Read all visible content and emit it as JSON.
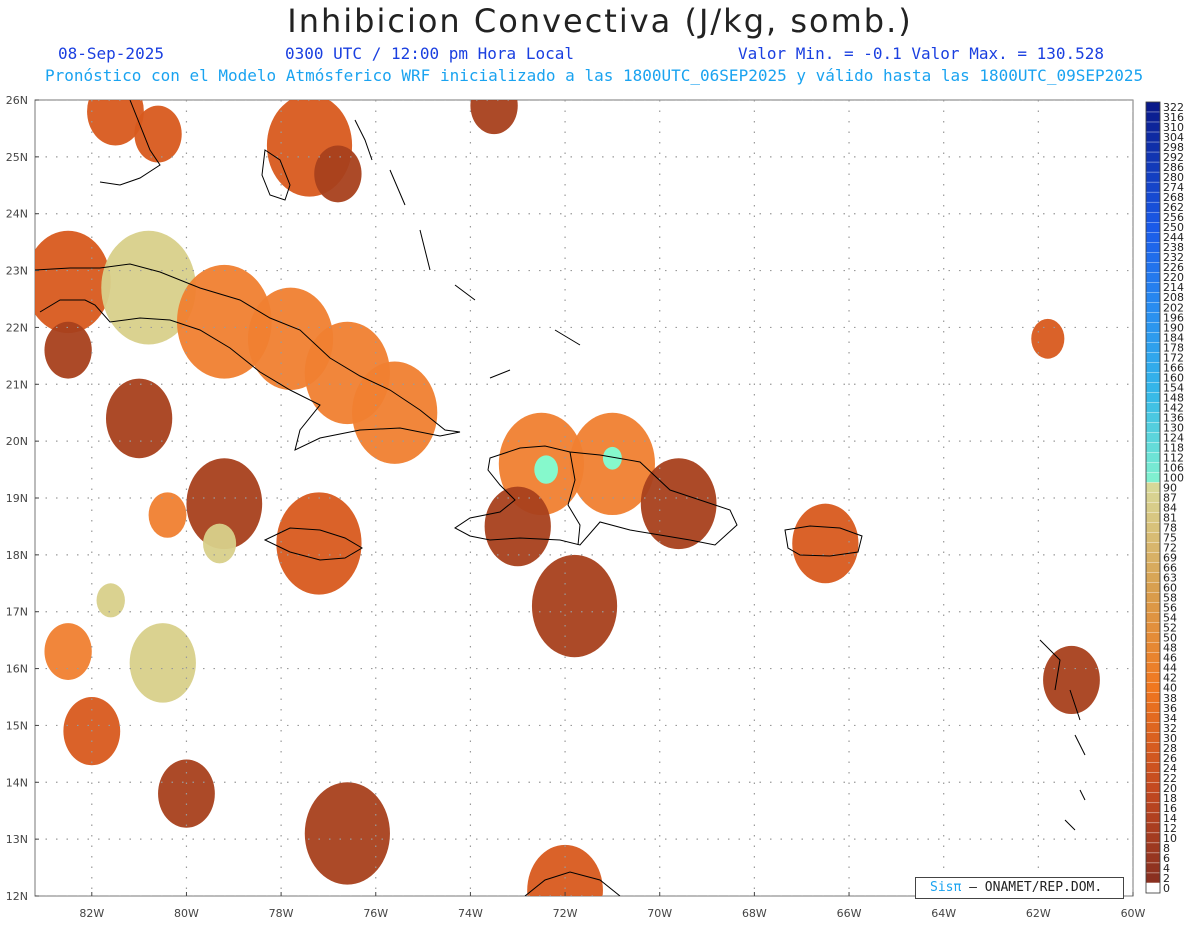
{
  "header": {
    "title": "Inhibicion Convectiva (J/kg, somb.)",
    "date": "08-Sep-2025",
    "time": "0300 UTC / 12:00 pm Hora Local",
    "min_max": "Valor Min. = -0.1  Valor Max. = 130.528",
    "model_info": "Pronóstico con el Modelo Atmósferico WRF inicializado a las 1800UTC_06SEP2025 y válido hasta las  1800UTC_09SEP2025"
  },
  "map": {
    "lat_ticks": [
      "26N",
      "25N",
      "24N",
      "23N",
      "22N",
      "21N",
      "20N",
      "19N",
      "18N",
      "17N",
      "16N",
      "15N",
      "14N",
      "13N",
      "12N"
    ],
    "lon_ticks": [
      "82W",
      "80W",
      "78W",
      "76W",
      "74W",
      "72W",
      "70W",
      "68W",
      "66W",
      "64W",
      "62W",
      "60W"
    ],
    "lat_range": [
      12,
      26
    ],
    "lon_range": [
      -83.2,
      -60
    ],
    "field_color": "#a8401c",
    "coast_color": "#000000",
    "grid_color": "#9a9a9a",
    "cin_cells": [
      {
        "lon": -81.5,
        "lat": 25.8,
        "r": 0.6,
        "v": 20
      },
      {
        "lon": -80.6,
        "lat": 25.4,
        "r": 0.5,
        "v": 25
      },
      {
        "lon": -77.4,
        "lat": 25.2,
        "r": 0.9,
        "v": 30
      },
      {
        "lon": -76.8,
        "lat": 24.7,
        "r": 0.5,
        "v": 18
      },
      {
        "lon": -73.5,
        "lat": 25.9,
        "r": 0.5,
        "v": 12
      },
      {
        "lon": -82.5,
        "lat": 22.8,
        "r": 0.9,
        "v": 30
      },
      {
        "lon": -80.8,
        "lat": 22.7,
        "r": 1.0,
        "v": 62
      },
      {
        "lon": -79.2,
        "lat": 22.1,
        "r": 1.0,
        "v": 55
      },
      {
        "lon": -77.8,
        "lat": 21.8,
        "r": 0.9,
        "v": 58
      },
      {
        "lon": -76.6,
        "lat": 21.2,
        "r": 0.9,
        "v": 50
      },
      {
        "lon": -75.6,
        "lat": 20.5,
        "r": 0.9,
        "v": 40
      },
      {
        "lon": -82.5,
        "lat": 21.6,
        "r": 0.5,
        "v": 15
      },
      {
        "lon": -81.0,
        "lat": 20.4,
        "r": 0.7,
        "v": 15
      },
      {
        "lon": -79.2,
        "lat": 18.9,
        "r": 0.8,
        "v": 18
      },
      {
        "lon": -77.2,
        "lat": 18.2,
        "r": 0.9,
        "v": 25
      },
      {
        "lon": -80.4,
        "lat": 18.7,
        "r": 0.4,
        "v": 40
      },
      {
        "lon": -79.3,
        "lat": 18.2,
        "r": 0.35,
        "v": 70
      },
      {
        "lon": -72.5,
        "lat": 19.6,
        "r": 0.9,
        "v": 45
      },
      {
        "lon": -72.4,
        "lat": 19.5,
        "r": 0.25,
        "v": 110
      },
      {
        "lon": -71.0,
        "lat": 19.6,
        "r": 0.9,
        "v": 40
      },
      {
        "lon": -71.0,
        "lat": 19.7,
        "r": 0.2,
        "v": 105
      },
      {
        "lon": -69.6,
        "lat": 18.9,
        "r": 0.8,
        "v": 18
      },
      {
        "lon": -73.0,
        "lat": 18.5,
        "r": 0.7,
        "v": 15
      },
      {
        "lon": -71.8,
        "lat": 17.1,
        "r": 0.9,
        "v": 15
      },
      {
        "lon": -66.5,
        "lat": 18.2,
        "r": 0.7,
        "v": 20
      },
      {
        "lon": -61.8,
        "lat": 21.8,
        "r": 0.35,
        "v": 30
      },
      {
        "lon": -80.5,
        "lat": 16.1,
        "r": 0.7,
        "v": 65
      },
      {
        "lon": -82.5,
        "lat": 16.3,
        "r": 0.5,
        "v": 45
      },
      {
        "lon": -82.0,
        "lat": 14.9,
        "r": 0.6,
        "v": 20
      },
      {
        "lon": -80.0,
        "lat": 13.8,
        "r": 0.6,
        "v": 18
      },
      {
        "lon": -76.6,
        "lat": 13.1,
        "r": 0.9,
        "v": 15
      },
      {
        "lon": -72.0,
        "lat": 12.1,
        "r": 0.8,
        "v": 20
      },
      {
        "lon": -61.3,
        "lat": 15.8,
        "r": 0.6,
        "v": 18
      },
      {
        "lon": -81.6,
        "lat": 17.2,
        "r": 0.3,
        "v": 60
      }
    ]
  },
  "colorbar": {
    "labels": [
      "322",
      "316",
      "310",
      "304",
      "298",
      "292",
      "286",
      "280",
      "274",
      "268",
      "262",
      "256",
      "250",
      "244",
      "238",
      "232",
      "226",
      "220",
      "214",
      "208",
      "202",
      "196",
      "190",
      "184",
      "178",
      "172",
      "166",
      "160",
      "154",
      "148",
      "142",
      "136",
      "130",
      "124",
      "118",
      "112",
      "106",
      "100",
      "90",
      "87",
      "84",
      "81",
      "78",
      "75",
      "72",
      "69",
      "66",
      "63",
      "60",
      "58",
      "56",
      "54",
      "52",
      "50",
      "48",
      "46",
      "44",
      "42",
      "40",
      "38",
      "36",
      "34",
      "32",
      "30",
      "28",
      "26",
      "24",
      "22",
      "20",
      "18",
      "16",
      "14",
      "12",
      "10",
      "8",
      "6",
      "4",
      "2",
      "0"
    ]
  },
  "credit": {
    "sis": "Sisπ",
    "org": "– ONAMET/REP.DOM."
  }
}
